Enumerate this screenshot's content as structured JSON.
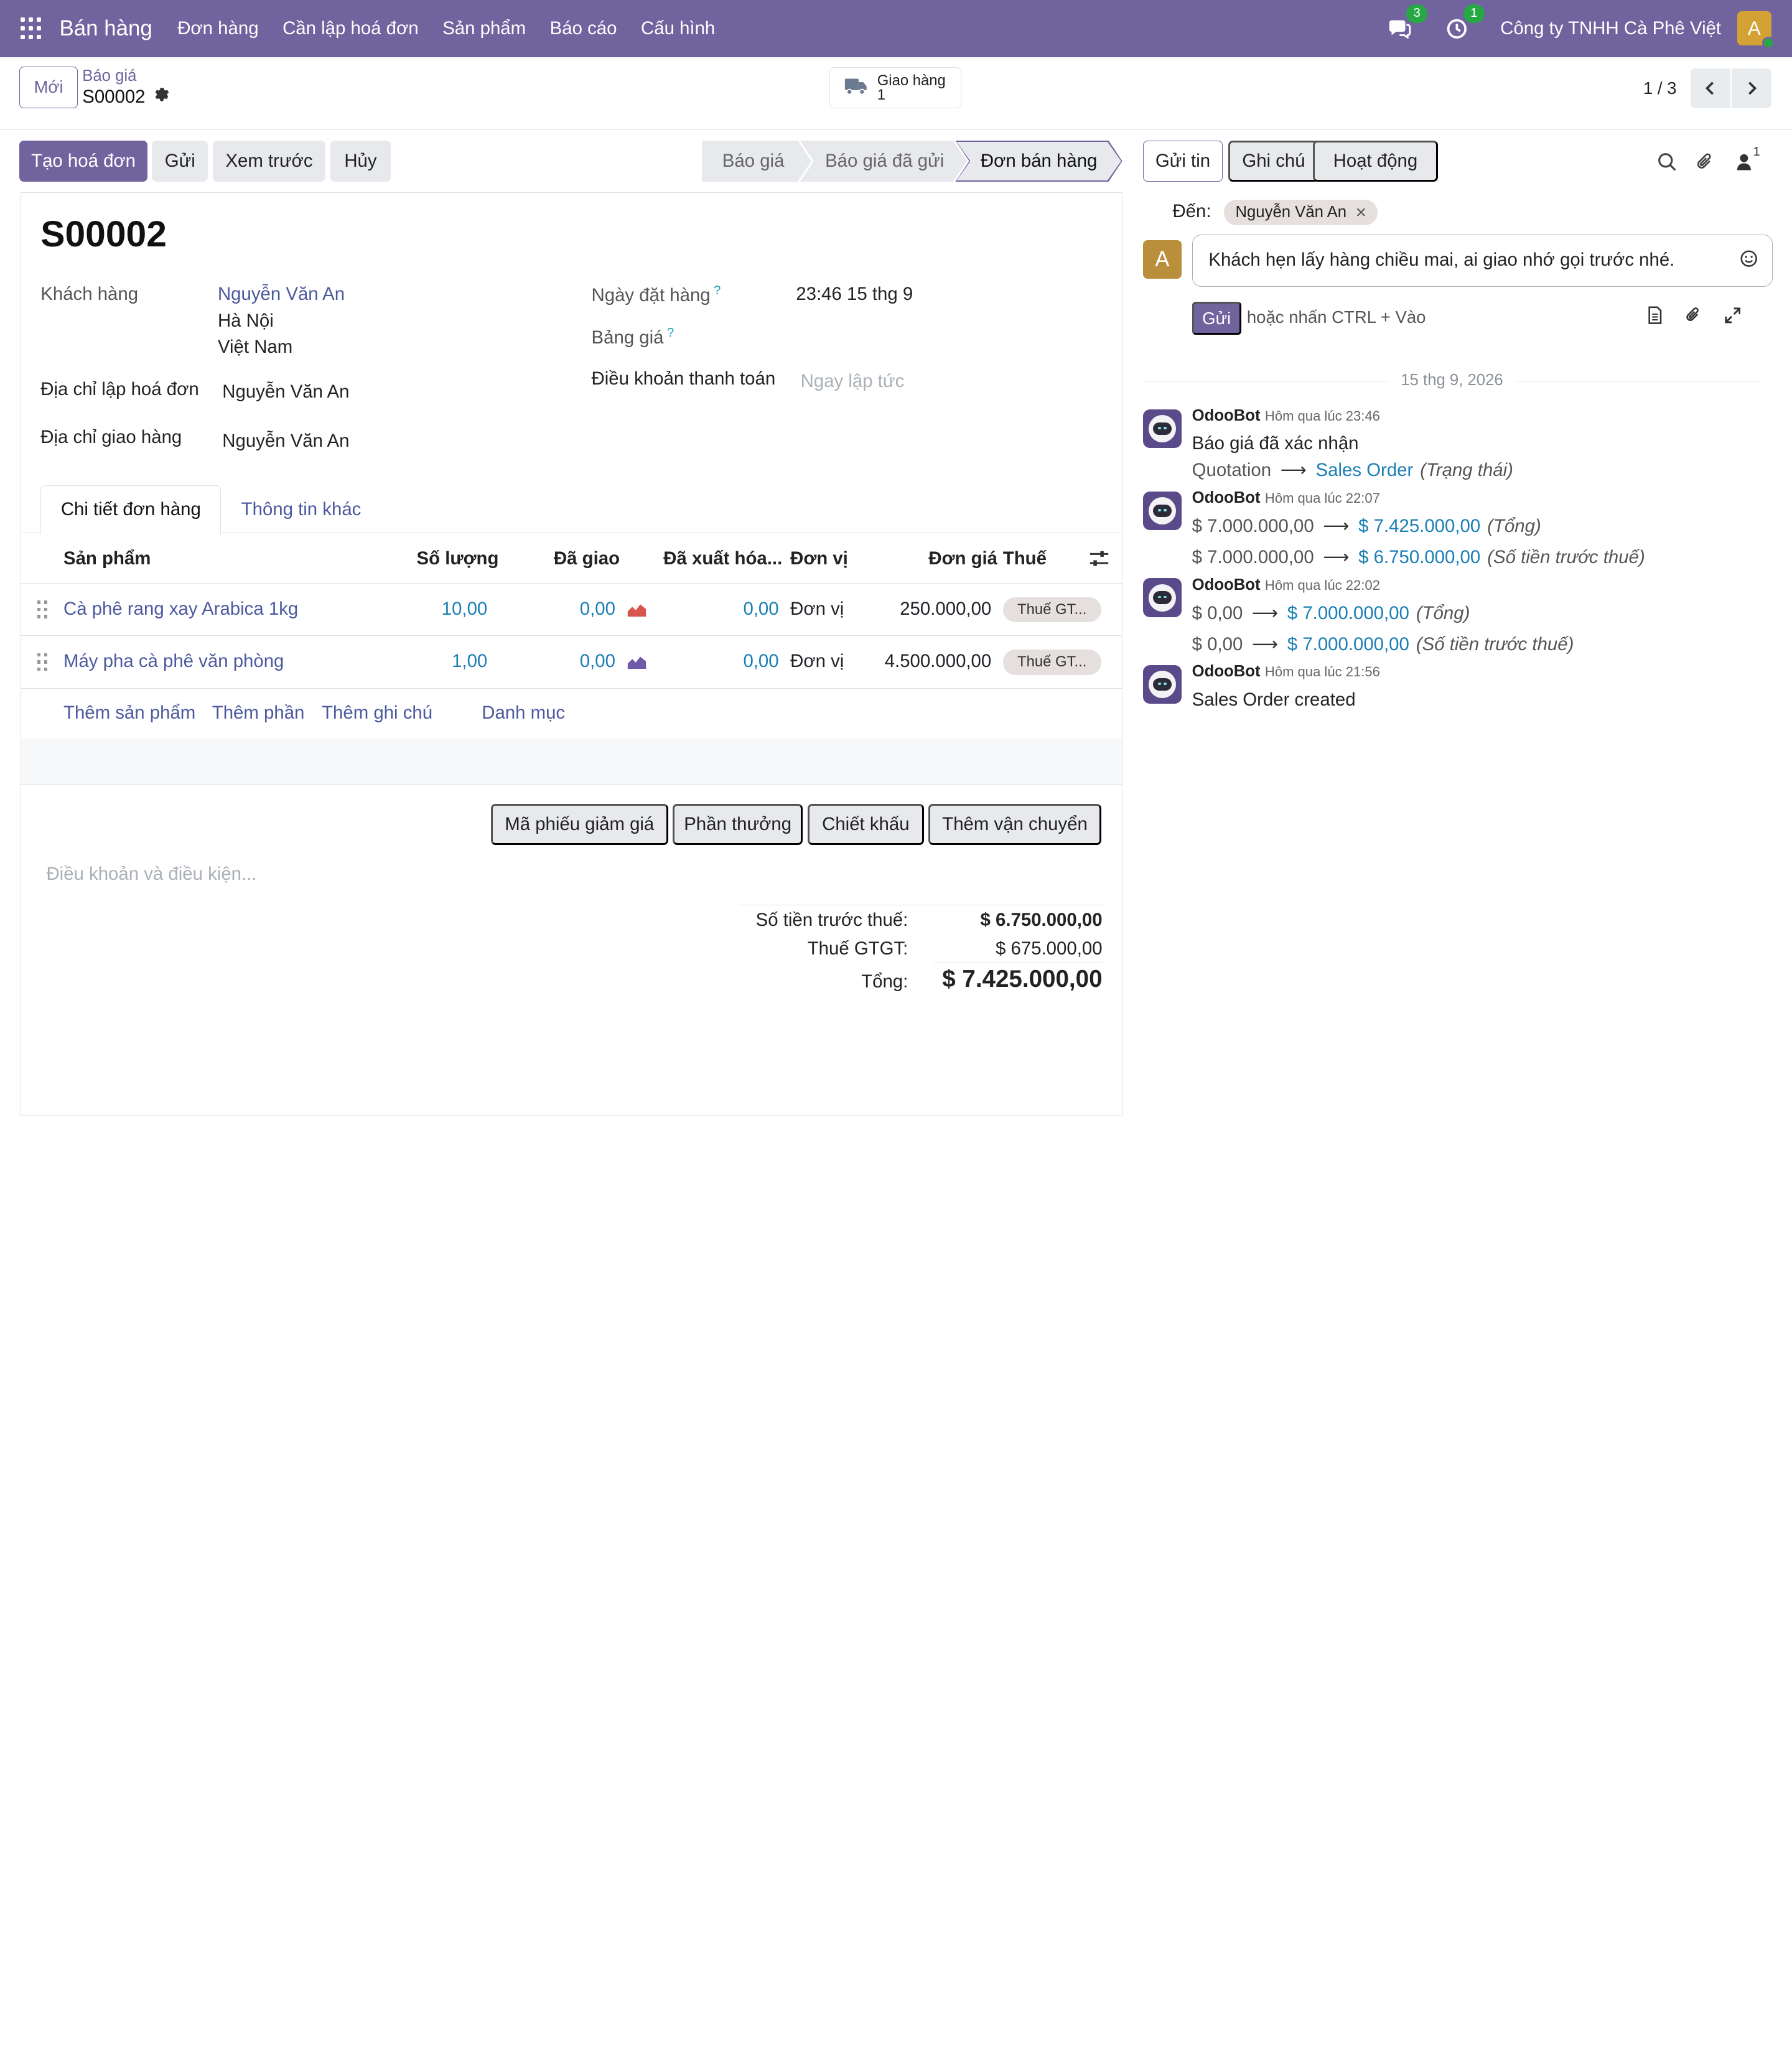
{
  "navbar": {
    "brand": "Bán hàng",
    "menu": [
      "Đơn hàng",
      "Cần lập hoá đơn",
      "Sản phẩm",
      "Báo cáo",
      "Cấu hình"
    ],
    "messages_count": "3",
    "activities_count": "1",
    "company": "Công ty TNHH Cà Phê Việt",
    "avatar_letter": "A"
  },
  "control": {
    "new_label": "Mới",
    "breadcrumb_parent": "Báo giá",
    "breadcrumb_current": "S00002",
    "delivery_label": "Giao hàng",
    "delivery_count": "1",
    "pager": "1 / 3"
  },
  "actions": {
    "create_invoice": "Tạo hoá đơn",
    "send": "Gửi",
    "preview": "Xem trước",
    "cancel": "Hủy"
  },
  "stages": [
    "Báo giá",
    "Báo giá đã gửi",
    "Đơn bán hàng"
  ],
  "active_stage": "Đơn bán hàng",
  "form": {
    "order_name": "S00002",
    "customer_label": "Khách hàng",
    "customer_name": "Nguyễn Văn An",
    "customer_city": "Hà Nội",
    "customer_country": "Việt Nam",
    "invoice_address_label": "Địa chỉ lập hoá đơn",
    "invoice_address": "Nguyễn Văn An",
    "delivery_address_label": "Địa chỉ giao hàng",
    "delivery_address": "Nguyễn Văn An",
    "order_date_label": "Ngày đặt hàng",
    "order_date": "23:46 15 thg 9",
    "pricelist_label": "Bảng giá",
    "payment_terms_label": "Điều khoản thanh toán",
    "payment_terms_placeholder": "Ngay lập tức",
    "help_mark": "?"
  },
  "tabs": [
    "Chi tiết đơn hàng",
    "Thông tin khác"
  ],
  "table": {
    "headers": {
      "product": "Sản phẩm",
      "quantity": "Số lượng",
      "delivered": "Đã giao",
      "invoiced": "Đã xuất hóa...",
      "uom": "Đơn vị",
      "price": "Đơn giá",
      "tax": "Thuế"
    },
    "rows": [
      {
        "product": "Cà phê rang xay Arabica 1kg",
        "quantity": "10,00",
        "delivered": "0,00",
        "invoiced": "0,00",
        "uom": "Đơn vị",
        "price": "250.000,00",
        "tax": "Thuế GT..."
      },
      {
        "product": "Máy pha cà phê văn phòng",
        "quantity": "1,00",
        "delivered": "0,00",
        "invoiced": "0,00",
        "uom": "Đơn vị",
        "price": "4.500.000,00",
        "tax": "Thuế GT..."
      }
    ],
    "add_links": [
      "Thêm sản phẩm",
      "Thêm phần",
      "Thêm ghi chú",
      "Danh mục"
    ]
  },
  "extra_buttons": [
    "Mã phiếu giảm giá",
    "Phần thưởng",
    "Chiết khấu",
    "Thêm vận chuyển"
  ],
  "terms_placeholder": "Điều khoản và điều kiện...",
  "totals": {
    "untaxed_label": "Số tiền trước thuế:",
    "untaxed": "$ 6.750.000,00",
    "tax_label": "Thuế GTGT:",
    "tax": "$ 675.000,00",
    "total_label": "Tổng:",
    "total": "$ 7.425.000,00"
  },
  "chatter": {
    "send_message": "Gửi tin",
    "log_note": "Ghi chú",
    "activities": "Hoạt động",
    "followers_count": "1",
    "to_label": "Đến:",
    "recipient": "Nguyễn Văn An",
    "remove_mark": "×",
    "composer_avatar": "A",
    "composer_text": "Khách hẹn lấy hàng chiều mai, ai giao nhớ gọi trước nhé.",
    "send_button": "Gửi",
    "send_hint": "hoặc nhấn CTRL + Vào",
    "date_separator": "15 thg 9, 2026",
    "messages": [
      {
        "author": "OdooBot",
        "time": "Hôm qua lúc 23:46",
        "body": "Báo giá đã xác nhận",
        "changes": [
          {
            "old": "Quotation",
            "new": "Sales Order",
            "field": "(Trạng thái)"
          }
        ]
      },
      {
        "author": "OdooBot",
        "time": "Hôm qua lúc 22:07",
        "changes": [
          {
            "old": "$ 7.000.000,00",
            "new": "$ 7.425.000,00",
            "field": "(Tổng)"
          },
          {
            "old": "$ 7.000.000,00",
            "new": "$ 6.750.000,00",
            "field": "(Số tiền trước thuế)"
          }
        ]
      },
      {
        "author": "OdooBot",
        "time": "Hôm qua lúc 22:02",
        "changes": [
          {
            "old": "$ 0,00",
            "new": "$ 7.000.000,00",
            "field": "(Tổng)"
          },
          {
            "old": "$ 0,00",
            "new": "$ 7.000.000,00",
            "field": "(Số tiền trước thuế)"
          }
        ]
      },
      {
        "author": "OdooBot",
        "time": "Hôm qua lúc 21:56",
        "body": "Sales Order created"
      }
    ]
  },
  "colors": {
    "brand": "#71639e",
    "link": "#4b5a9e",
    "value_link": "#1a7fb5",
    "badge_green": "#28a745",
    "forecast_red": "#d9534f",
    "forecast_purple": "#6f5aa8"
  },
  "icons": [
    "apps-grid-icon",
    "chat-icon",
    "clock-icon",
    "truck-icon",
    "gear-icon",
    "chevron-left-icon",
    "chevron-right-icon",
    "drag-handle-icon",
    "forecast-chart-icon",
    "column-settings-icon",
    "search-icon",
    "paperclip-icon",
    "user-icon",
    "emoji-icon",
    "document-icon",
    "expand-icon"
  ]
}
